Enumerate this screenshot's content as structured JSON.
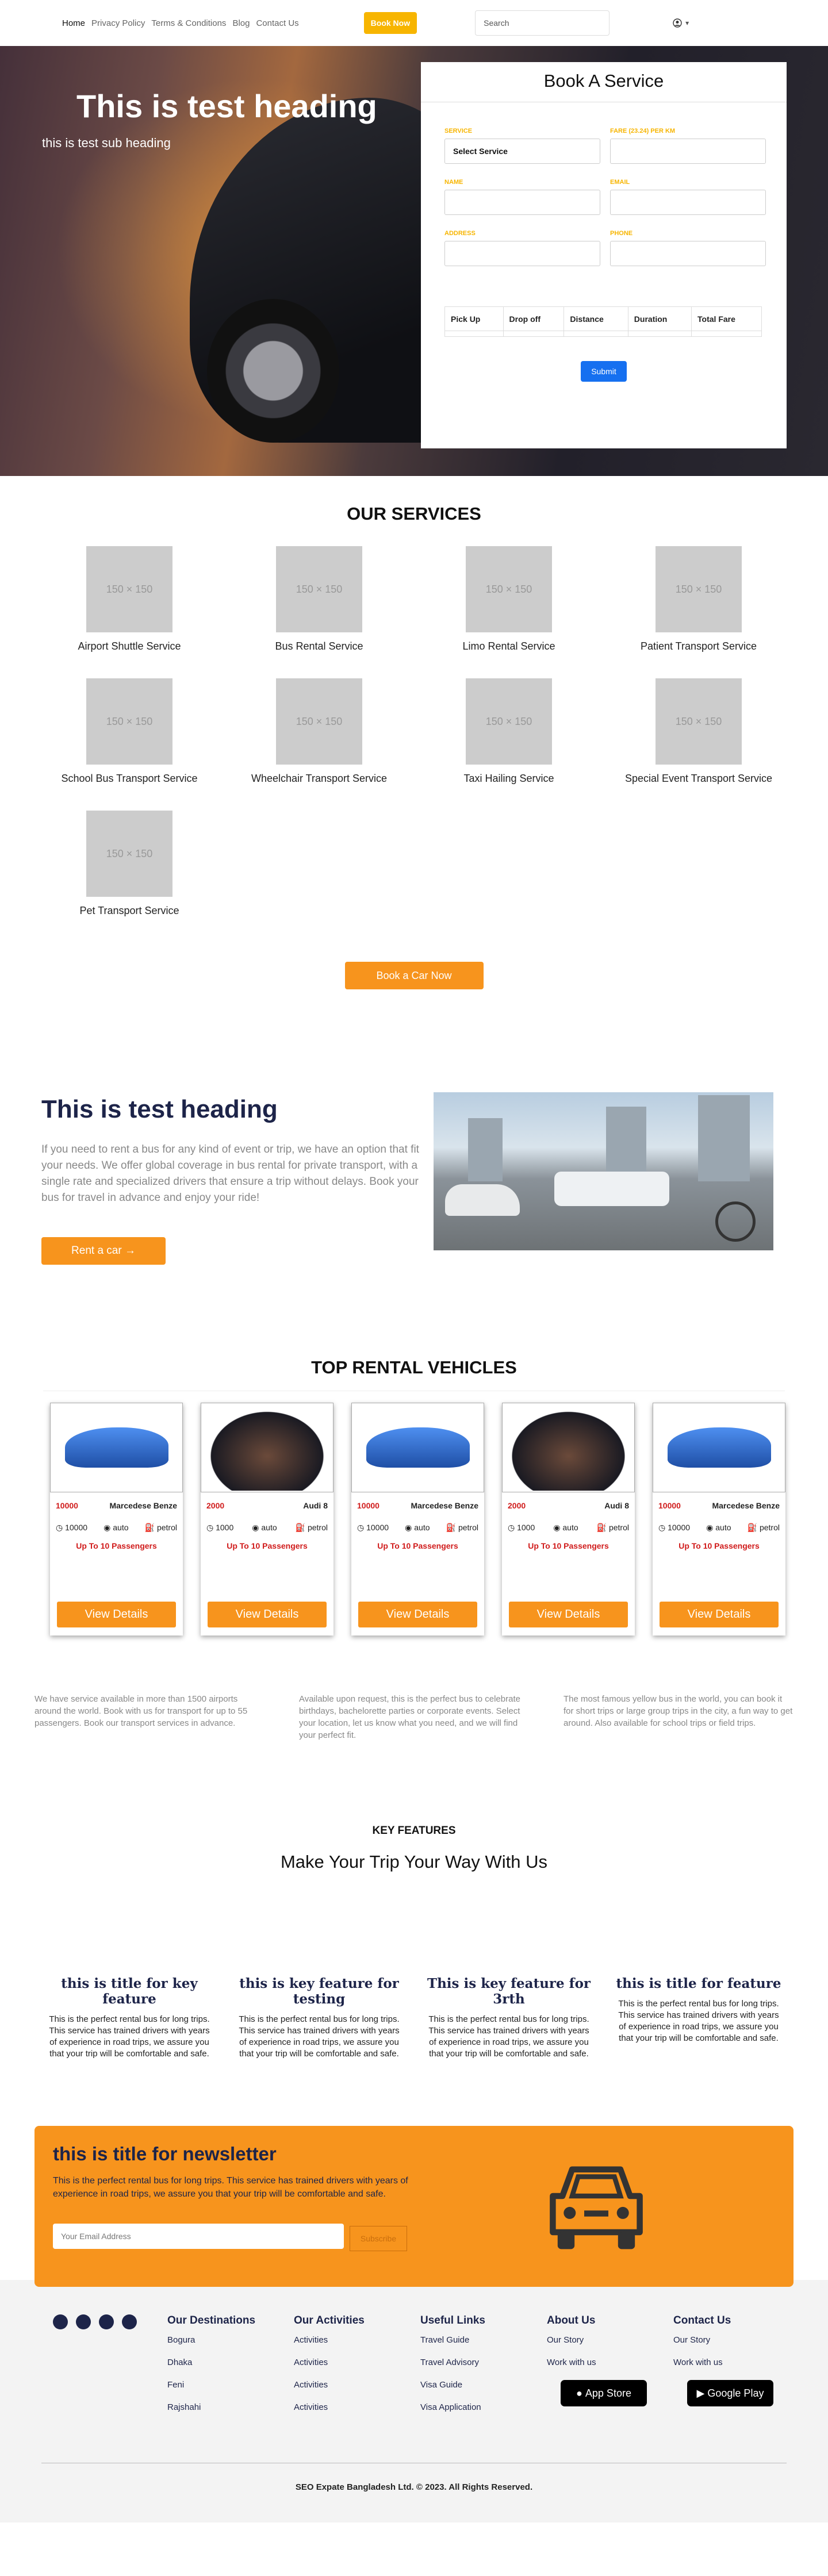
{
  "nav": {
    "links": [
      "Home",
      "Privacy Policy",
      "Terms & Conditions",
      "Blog",
      "Contact Us"
    ],
    "book_now": "Book Now",
    "search_placeholder": "Search"
  },
  "hero": {
    "heading": "This is test heading",
    "subheading": "this is test sub heading"
  },
  "booking": {
    "title": "Book A Service",
    "fields": [
      {
        "label": "SERVICE",
        "value": "Select Service"
      },
      {
        "label": "FARE (23.24) PER KM",
        "value": ""
      },
      {
        "label": "NAME",
        "value": ""
      },
      {
        "label": "EMAIL",
        "value": ""
      },
      {
        "label": "ADDRESS",
        "value": ""
      },
      {
        "label": "PHONE",
        "value": ""
      }
    ],
    "table_headers": [
      "Pick Up",
      "Drop off",
      "Distance",
      "Duration",
      "Total Fare"
    ],
    "submit": "Submit"
  },
  "services": {
    "title": "OUR SERVICES",
    "placeholder_text": "150 × 150",
    "items": [
      "Airport Shuttle Service",
      "Bus Rental Service",
      "Limo Rental Service",
      "Patient Transport Service",
      "School Bus Transport Service",
      "Wheelchair Transport Service",
      "Taxi Hailing Service",
      "Special Event Transport Service",
      "Pet Transport Service"
    ],
    "cta": "Book a Car Now"
  },
  "about": {
    "heading": "This is test heading",
    "text": "If you need to rent a bus for any kind of event or trip, we have an option that fit your needs. We offer global coverage in bus rental for private transport, with a single rate and specialized drivers that ensure a trip without delays. Book your bus for travel in advance and enjoy your ride!",
    "button": "Rent a car →"
  },
  "vehicles": {
    "title": "TOP RENTAL VEHICLES",
    "items": [
      {
        "price": "10000",
        "name": "Marcedese Benze",
        "mileage": "10000",
        "trans": "auto",
        "fuel": "petrol",
        "pass": "Up To 10 Passengers",
        "btn": "View Details",
        "img": "blue-car"
      },
      {
        "price": "2000",
        "name": "Audi 8",
        "mileage": "1000",
        "trans": "auto",
        "fuel": "petrol",
        "pass": "Up To 10 Passengers",
        "btn": "View Details",
        "img": "dashboard"
      },
      {
        "price": "10000",
        "name": "Marcedese Benze",
        "mileage": "10000",
        "trans": "auto",
        "fuel": "petrol",
        "pass": "Up To 10 Passengers",
        "btn": "View Details",
        "img": "blue-car"
      },
      {
        "price": "2000",
        "name": "Audi 8",
        "mileage": "1000",
        "trans": "auto",
        "fuel": "petrol",
        "pass": "Up To 10 Passengers",
        "btn": "View Details",
        "img": "dashboard"
      },
      {
        "price": "10000",
        "name": "Marcedese Benze",
        "mileage": "10000",
        "trans": "auto",
        "fuel": "petrol",
        "pass": "Up To 10 Passengers",
        "btn": "View Details",
        "img": "blue-car"
      }
    ]
  },
  "columns": [
    "We have service available in more than 1500 airports around the world. Book with us for transport for up to 55 passengers. Book our transport services in advance.",
    "Available upon request, this is the perfect bus to celebrate birthdays, bachelorette parties or corporate events. Select your location, let us know what you need, and we will find your perfect fit.",
    "The most famous yellow bus in the world, you can book it for short trips or large group trips in the city, a fun way to get around. Also available for school trips or field trips."
  ],
  "features": {
    "kicker": "KEY FEATURES",
    "title": "Make Your Trip Your Way With Us",
    "items": [
      {
        "title": "this is title for key feature",
        "text": "This is the perfect rental bus for long trips. This service has trained drivers with years of experience in road trips, we assure you that your trip will be comfortable and safe."
      },
      {
        "title": "this is key feature for testing",
        "text": "This is the perfect rental bus for long trips. This service has trained drivers with years of experience in road trips, we assure you that your trip will be comfortable and safe."
      },
      {
        "title": "This is key feature for 3rth",
        "text": "This is the perfect rental bus for long trips. This service has trained drivers with years of experience in road trips, we assure you that your trip will be comfortable and safe."
      },
      {
        "title": "this is title for feature",
        "text": "This is the perfect rental bus for long trips. This service has trained drivers with years of experience in road trips, we assure you that your trip will be comfortable and safe."
      }
    ]
  },
  "newsletter": {
    "title": "this is title for newsletter",
    "text": "This is the perfect rental bus for long trips. This service has trained drivers with years of experience in road trips, we assure you that your trip will be comfortable and safe.",
    "placeholder": "Your Email Address",
    "button": "Subscribe"
  },
  "footer": {
    "destinations": {
      "title": "Our Destinations",
      "items": [
        "Bogura",
        "Dhaka",
        "Feni",
        "Rajshahi"
      ]
    },
    "activities": {
      "title": "Our Activities",
      "items": [
        "Activities",
        "Activities",
        "Activities",
        "Activities"
      ]
    },
    "useful": {
      "title": "Useful Links",
      "items": [
        "Travel Guide",
        "Travel Advisory",
        "Visa Guide",
        "Visa Application"
      ]
    },
    "about": {
      "title": "About Us",
      "items": [
        "Our Story",
        "Work with us"
      ]
    },
    "contact": {
      "title": "Contact Us",
      "items": [
        "Our Story",
        "Work with us"
      ]
    },
    "app_store": "App Store",
    "google_play": "Google Play",
    "copyright": "SEO Expate Bangladesh Ltd. © 2023. All Rights Reserved."
  },
  "colors": {
    "accent": "#f7941d",
    "nav_button": "#f7b500",
    "navy": "#1d2449",
    "submit": "#1670f0"
  }
}
